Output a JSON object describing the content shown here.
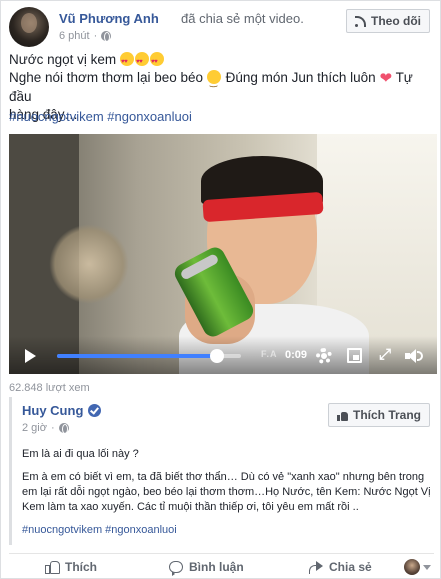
{
  "post": {
    "author": "Vũ Phương Anh",
    "action": "đã chia sẻ một video.",
    "time": "6 phút",
    "follow_label": "Theo dõi",
    "line1": "Nước ngọt vị kem",
    "line2_a": "Nghe nói thơm thơm lại beo béo",
    "line2_b": "Đúng món Jun thích luôn",
    "line2_c": "Tự đầu",
    "line3": "hàng đây…",
    "hashtags": "#nuocngotvikem #ngonxoanluoi"
  },
  "video": {
    "time": "0:09",
    "watermark": "F.A",
    "progress_fraction": 0.87,
    "views": "62.848 lượt xem"
  },
  "shared": {
    "author": "Huy Cung",
    "time": "2 giờ",
    "like_page_label": "Thích Trang",
    "para1": "Em là ai đi qua lối này ?",
    "para2": "Em à em có biết vì em, ta đã biết thơ thẩn… Dù có vẻ \"xanh xao\" nhưng bên trong em lại rất dỗi ngọt ngào, beo béo lại thơm thơm…Họ Nước, tên Kem: Nước Ngọt Vị Kem làm ta xao xuyến. Các tỉ muội thần thiếp ơi, tôi yêu em mất rồi ..",
    "hashtags": "#nuocngotvikem #ngonxoanluoi"
  },
  "actions": {
    "like": "Thích",
    "comment": "Bình luận",
    "share": "Chia sẻ"
  },
  "colors": {
    "link": "#365899",
    "accent": "#4080ff",
    "meta": "#90949c"
  }
}
